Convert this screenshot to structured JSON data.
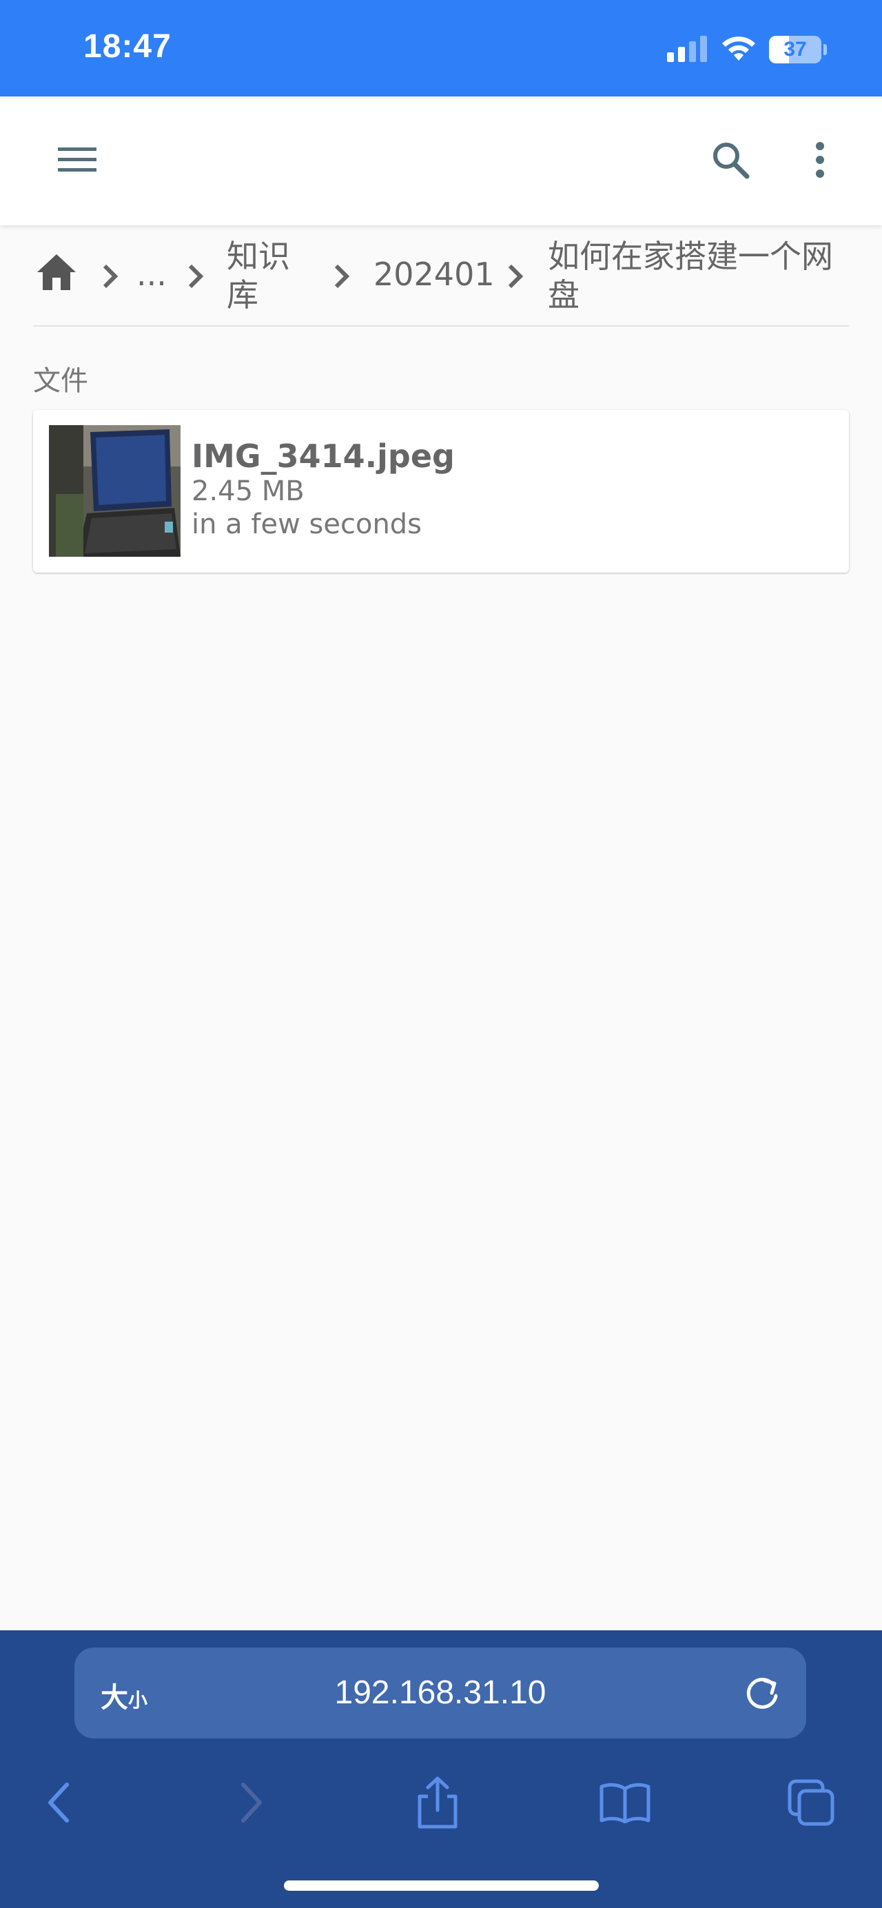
{
  "status_bar": {
    "time": "18:47",
    "battery_level": "37",
    "icons": [
      "cellular-signal-icon",
      "wifi-icon",
      "battery-icon"
    ]
  },
  "app_bar": {
    "icons": [
      "menu-icon",
      "search-icon",
      "more-vertical-icon"
    ]
  },
  "breadcrumb": {
    "items": [
      {
        "label": "",
        "icon": "home-icon"
      },
      {
        "label": "..."
      },
      {
        "label": "知识库"
      },
      {
        "label": "202401"
      },
      {
        "label": "如何在家搭建一个网盘"
      }
    ]
  },
  "section": {
    "label": "文件"
  },
  "files": [
    {
      "name": "IMG_3414.jpeg",
      "size": "2.45 MB",
      "modified": "in a few seconds"
    }
  ],
  "browser": {
    "text_size_label": "大",
    "text_size_small": "小",
    "url": "192.168.31.10",
    "toolbar_icons": [
      "back-icon",
      "forward-icon",
      "share-icon",
      "bookmarks-icon",
      "tabs-icon"
    ]
  },
  "colors": {
    "status_bar": "#2f80f8",
    "safari_bar": "#23498f",
    "address_field": "#4069ae",
    "page_bg": "#fafafa"
  }
}
